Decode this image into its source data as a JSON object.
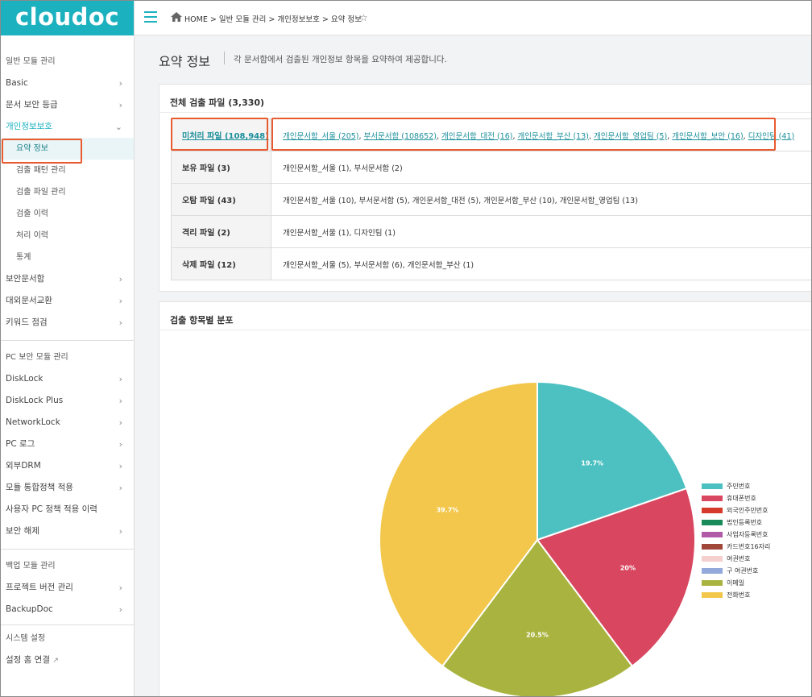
{
  "app": {
    "logo": "cloudoc"
  },
  "sidebar": {
    "sections": [
      {
        "title": "일반 모듈 관리"
      },
      {
        "title": "PC 보안 모듈 관리"
      },
      {
        "title": "백업 모듈 관리"
      },
      {
        "title": "시스템 설정"
      }
    ],
    "general_items": [
      {
        "label": "Basic"
      },
      {
        "label": "문서 보안 등급"
      },
      {
        "label": "개인정보보호"
      }
    ],
    "privacy_sub": [
      {
        "label": "요약 정보"
      },
      {
        "label": "검출 패턴 관리"
      },
      {
        "label": "검출 파일 관리"
      },
      {
        "label": "검출 이력"
      },
      {
        "label": "처리 이력"
      },
      {
        "label": "통계"
      }
    ],
    "general_items2": [
      {
        "label": "보안문서함"
      },
      {
        "label": "대외문서교환"
      },
      {
        "label": "키워드 점검"
      }
    ],
    "pc_items": [
      {
        "label": "DiskLock"
      },
      {
        "label": "DiskLock Plus"
      },
      {
        "label": "NetworkLock"
      },
      {
        "label": "PC 로그"
      },
      {
        "label": "외부DRM"
      },
      {
        "label": "모듈 통합정책 적용"
      },
      {
        "label": "사용자 PC 정책 적용 이력"
      },
      {
        "label": "보안 해제"
      }
    ],
    "backup_items": [
      {
        "label": "프로젝트 버전 관리"
      },
      {
        "label": "BackupDoc"
      }
    ],
    "system_items": [
      {
        "label": "설정 홈 연결"
      }
    ]
  },
  "breadcrumb": {
    "home": "HOME",
    "sep": ">",
    "items": [
      "일반 모듈 관리",
      "개인정보보호",
      "요약 정보"
    ]
  },
  "page": {
    "title": "요약 정보",
    "description": "각 문서함에서 검출된 개인정보 항목을 요약하여 제공합니다."
  },
  "summary": {
    "title": "전체 검출 파일 (3,330)",
    "rows": [
      {
        "label": "미처리 파일 (108,948)",
        "link": true,
        "values": [
          "개인문서함_서울 (205)",
          "부서문서함 (108652)",
          "개인문서함_대전 (16)",
          "개인문서함_부산 (13)",
          "개인문서함_영업팀 (5)",
          "개인문서함_보안 (16)",
          "디자인팀 (41)"
        ]
      },
      {
        "label": "보유 파일 (3)",
        "link": false,
        "values": [
          "개인문서함_서울 (1)",
          "부서문서함 (2)"
        ]
      },
      {
        "label": "오탐 파일 (43)",
        "link": false,
        "values": [
          "개인문서함_서울 (10)",
          "부서문서함 (5)",
          "개인문서함_대전 (5)",
          "개인문서함_부산 (10)",
          "개인문서함_영업팀 (13)"
        ]
      },
      {
        "label": "격리 파일 (2)",
        "link": false,
        "values": [
          "개인문서함_서울 (1)",
          "디자인팀 (1)"
        ]
      },
      {
        "label": "삭제 파일 (12)",
        "link": false,
        "values": [
          "개인문서함_서울 (5)",
          "부서문서함 (6)",
          "개인문서함_부산 (1)"
        ]
      }
    ]
  },
  "chart_card": {
    "title": "검출 항목별 분포"
  },
  "chart_data": {
    "type": "pie",
    "slices": [
      {
        "label": "주민번호",
        "value": 19.7,
        "display": "19.7%",
        "color": "#4dc1c1"
      },
      {
        "label": "휴대폰번호",
        "value": 20.0,
        "display": "20%",
        "color": "#d9465f"
      },
      {
        "label": "외국인주민번호",
        "value": 0,
        "display": "",
        "color": "#d53a2a"
      },
      {
        "label": "법인등록번호",
        "value": 0,
        "display": "",
        "color": "#1b8a5a"
      },
      {
        "label": "사업자등록번호",
        "value": 0,
        "display": "",
        "color": "#b15ba8"
      },
      {
        "label": "카드번호16자리",
        "value": 0,
        "display": "",
        "color": "#a0473a"
      },
      {
        "label": "여권번호",
        "value": 0,
        "display": "",
        "color": "#f6cfcf"
      },
      {
        "label": "구 여권번호",
        "value": 0,
        "display": "",
        "color": "#93a9dc"
      },
      {
        "label": "이메일",
        "value": 20.5,
        "display": "20.5%",
        "color": "#a9b440"
      },
      {
        "label": "전화번호",
        "value": 39.7,
        "display": "39.7%",
        "color": "#f2c74b"
      }
    ],
    "legend_position": "right"
  }
}
